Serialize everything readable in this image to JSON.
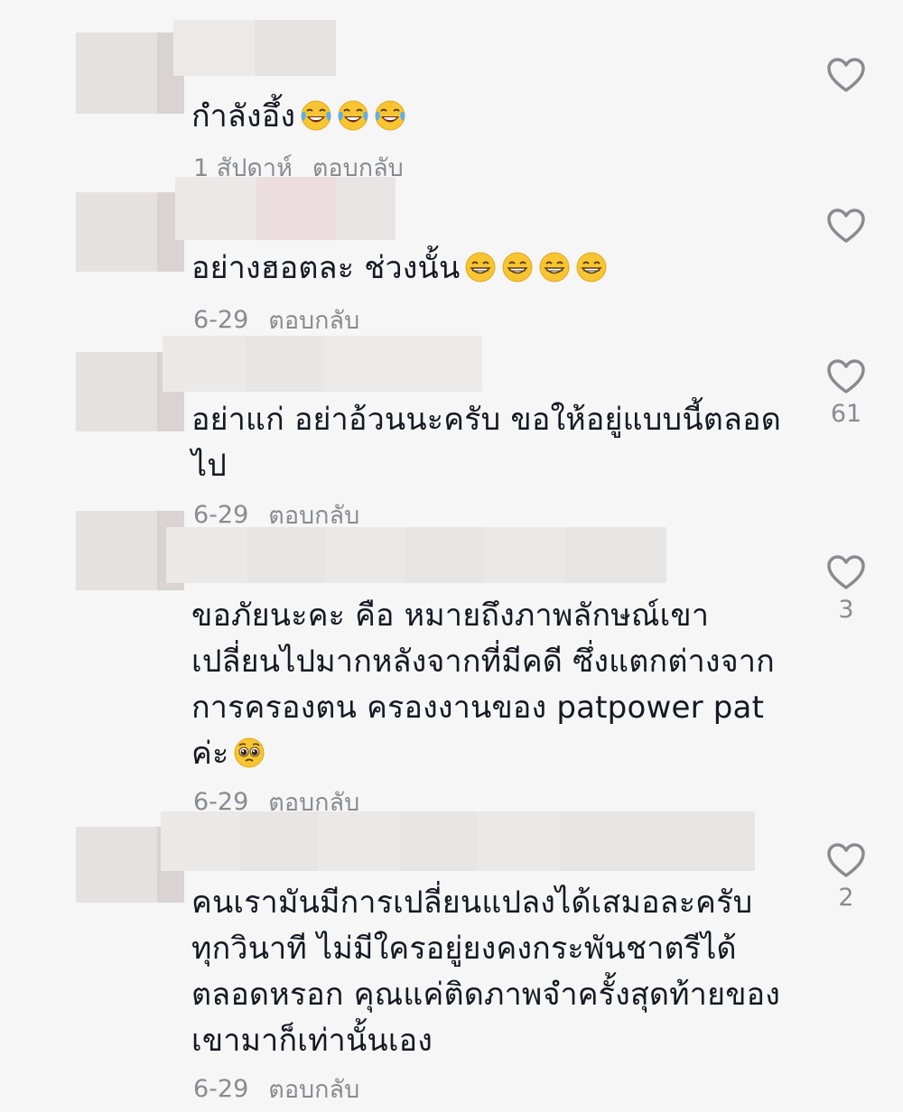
{
  "comments": [
    {
      "text": "กำลังอึ้ง",
      "emojis": [
        "laugh-cry",
        "laugh-cry",
        "laugh-cry"
      ],
      "time": "1 สัปดาห์",
      "reply_label": "ตอบกลับ",
      "likes": ""
    },
    {
      "text": "อย่างฮอตละ ช่วงนั้น",
      "emojis": [
        "grin",
        "grin",
        "grin",
        "grin"
      ],
      "time": "6-29",
      "reply_label": "ตอบกลับ",
      "likes": ""
    },
    {
      "text": "อย่าแก่ อย่าอ้วนนะครับ ขอให้อยู่แบบนี้ตลอด\nไป",
      "emojis": [],
      "time": "6-29",
      "reply_label": "ตอบกลับ",
      "likes": "61"
    },
    {
      "text": "ขอภัยนะคะ คือ หมายถึงภาพลักษณ์เขา\nเปลี่ยนไปมากหลังจากที่มีคดี ซึ่งแตกต่างจาก\nการครองตน ครองงานของ patpower pat\nค่ะ",
      "emojis": [
        "pleading"
      ],
      "time": "6-29",
      "reply_label": "ตอบกลับ",
      "likes": "3"
    },
    {
      "text": "คนเรามันมีการเปลี่ยนแปลงได้เสมอละครับ\nทุกวินาที ไม่มีใครอยู่ยงคงกระพันชาตรีได้\nตลอดหรอก คุณแค่ติดภาพจำครั้งสุดท้ายของ\nเขามาก็เท่านั้นเอง",
      "emojis": [],
      "time": "6-29",
      "reply_label": "ตอบกลับ",
      "likes": "2"
    }
  ],
  "colors": {
    "background": "#f6f6f6",
    "text": "#161823",
    "meta": "#8a8b91",
    "blur": "#e9e6e6",
    "emoji_face": "#f7c531"
  },
  "icons": {
    "like": "heart-outline-icon"
  }
}
